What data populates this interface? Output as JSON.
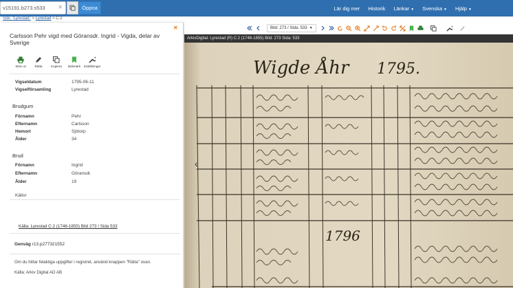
{
  "search": {
    "value": "v15191.b273.s533"
  },
  "open_button": "Öppna",
  "nav": [
    {
      "label": "Lär dig mer",
      "caret": false
    },
    {
      "label": "Historik",
      "caret": false
    },
    {
      "label": "Länkar",
      "caret": true
    },
    {
      "label": "Svenska",
      "caret": true
    },
    {
      "label": "Hjälp",
      "caret": true
    }
  ],
  "breadcrumb": {
    "prefix": "Sök:",
    "query": "\"Lyrestad\"",
    "sep1": ">",
    "place": "Lyrestad",
    "sep2": ">",
    "volume": "C:2"
  },
  "panel": {
    "title": "Carlsson Pehr vigd med Göransdr. Ingrid - Vigda, delar av Sverige",
    "actions": [
      "Skriv ut",
      "Rätta",
      "Kopiera",
      "Bokmärk",
      "Inställningar"
    ],
    "marriage": [
      {
        "k": "Vigseldatum",
        "v": "1795-06-11"
      },
      {
        "k": "Vigselförsamling",
        "v": "Lyrestad"
      }
    ],
    "groom_title": "Brudgum",
    "groom": [
      {
        "k": "Förnamn",
        "v": "Pehr"
      },
      {
        "k": "Efternamn",
        "v": "Carlsson"
      },
      {
        "k": "Hemort",
        "v": "Sjötorp"
      },
      {
        "k": "Ålder",
        "v": "34"
      }
    ],
    "bride_title": "Brud",
    "bride": [
      {
        "k": "Förnamn",
        "v": "Ingrid"
      },
      {
        "k": "Efternamn",
        "v": "Göransdr."
      },
      {
        "k": "Ålder",
        "v": "19"
      }
    ],
    "sources_title": "Källor",
    "source_link": "Källa: Lyrestad C:2 (1746-1855) Bild 273 / Sida 533",
    "shortcut_label": "Genväg",
    "shortcut_value": "r13.p277321552",
    "note1": "Om du hittar felaktiga uppgifter i registret, använd knappen \"Rätta\" ovan.",
    "note2": "Källa: Arkiv Digital AD AB"
  },
  "viewer": {
    "page_select": "Bild: 273 / Sida: 533",
    "header": "ArkivDigital: Lyrestad (R) C:2 (1746-1855) Bild: 273 Sida: 533",
    "doc_heading": "1795.",
    "doc_heading_script": "Wigde Åhr",
    "doc_year2": "1796"
  }
}
